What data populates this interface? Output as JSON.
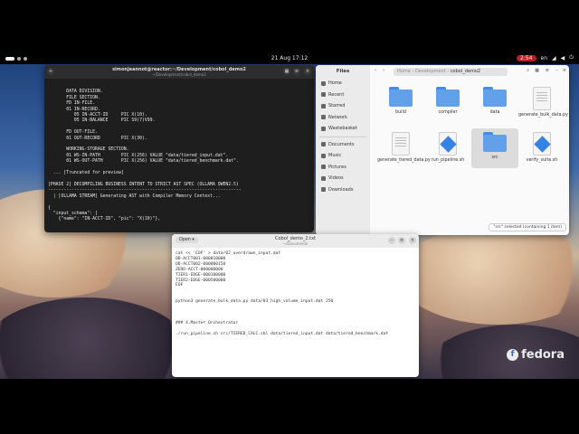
{
  "topbar": {
    "clock": "21 Aug 17:12",
    "status_pill": "2:54",
    "lang": "en"
  },
  "terminal": {
    "title": "simonjeannot@reactor:~/Development/cobol_demo2",
    "subtitle": "~/Development/cobol_demo2",
    "lines": [
      "",
      "       DATA DIVISION.",
      "       FILE SECTION.",
      "       FD IN-FILE.",
      "       01 IN-RECORD.",
      "          05 IN-ACCT-ID     PIC X(10).",
      "          05 IN-BALANCE     PIC S9(7)V99.",
      "",
      "       FD OUT-FILE.",
      "       01 OUT-RECORD        PIC X(30).",
      "",
      "       WORKING-STORAGE SECTION.",
      "       01 WS-IN-PATH        PIC X(256) VALUE \"data/tiered_input.dat\".",
      "       01 WS-OUT-PATH       PIC X(256) VALUE \"data/tiered_benchmark.dat\".",
      "",
      "  ... [Truncated for preview]",
      "",
      "[PHASE 2] DECOMPILING BUSINESS INTENT TO STRICT AST SPEC (OLLAMA QWEN2.5)",
      "--------------------------------------------------------------------------",
      "  | [OLLAMA STREAM] Generating AST with Compiler Memory Context...",
      "",
      "{",
      "  \"input_schema\": [",
      "    {\"name\": \"IN-ACCT-ID\", \"pic\": \"X(10)\"},"
    ]
  },
  "files": {
    "sidebar_title": "Files",
    "sidebar": [
      "Home",
      "Recent",
      "Starred",
      "Network",
      "Wastebasket",
      "Documents",
      "Music",
      "Pictures",
      "Videos",
      "Downloads"
    ],
    "path": [
      "Home",
      "Development",
      "cobol_demo2"
    ],
    "items": [
      {
        "name": "build",
        "kind": "folder"
      },
      {
        "name": "compiler",
        "kind": "folder"
      },
      {
        "name": "data",
        "kind": "folder"
      },
      {
        "name": "generate_bulk_data.py",
        "kind": "doc"
      },
      {
        "name": "generate_tiered_data.py",
        "kind": "doc"
      },
      {
        "name": "run_pipeline.sh",
        "kind": "script"
      },
      {
        "name": "src",
        "kind": "folder"
      },
      {
        "name": "verify_suite.sh",
        "kind": "script"
      }
    ],
    "status": "\"src\" selected (containing 1 item)"
  },
  "editor": {
    "open_label": "Open",
    "title": "Cobol_demo_2.txt",
    "subtitle": "~/Documents",
    "lines": [
      "cat << 'EOF' > data/02_overdrawn_input.dat",
      "OD-ACCT001-000010000",
      "OD-ACCT002-000000150",
      "ZERO-ACCT-000000000",
      "TIER1-EDGE-000100000",
      "TIER2-EDGE-000500000",
      "EOF",
      "",
      "",
      "python3 generate_bulk_data.py data/03_high_volume_input.dat 250",
      "",
      "",
      "",
      "### 4.Master Orchestrator",
      "",
      "./run_pipeline.sh src/TIERED_CALC.cbl data/tiered_input.dat data/tiered_benchmark.dat"
    ]
  },
  "brand": "fedora"
}
